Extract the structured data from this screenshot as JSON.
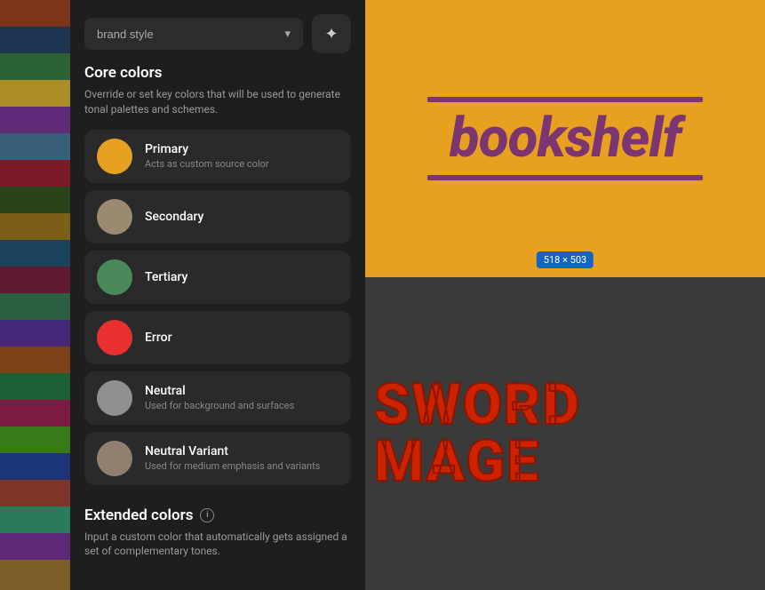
{
  "panel": {
    "dropdown_label": "brand style",
    "dropdown_icon": "▾",
    "magic_icon": "✦",
    "core_colors_title": "Core colors",
    "core_colors_desc": "Override or set key colors that will be used to generate tonal palettes and schemes.",
    "colors": [
      {
        "name": "Primary",
        "desc": "Acts as custom source color",
        "swatch": "#e8a020",
        "id": "primary"
      },
      {
        "name": "Secondary",
        "desc": "",
        "swatch": "#9a8a70",
        "id": "secondary"
      },
      {
        "name": "Tertiary",
        "desc": "",
        "swatch": "#4a8a5a",
        "id": "tertiary"
      },
      {
        "name": "Error",
        "desc": "",
        "swatch": "#e83030",
        "id": "error"
      },
      {
        "name": "Neutral",
        "desc": "Used for background and surfaces",
        "swatch": "#909090",
        "id": "neutral"
      },
      {
        "name": "Neutral Variant",
        "desc": "Used for medium emphasis and variants",
        "swatch": "#908070",
        "id": "neutral-variant"
      }
    ],
    "extended_title": "Extended colors",
    "extended_desc": "Input a custom color that automatically gets assigned a set of complementary tones."
  },
  "preview": {
    "logo_text": "bookshelf",
    "size_badge": "518 × 503",
    "sword_text": "SWORD MAGE"
  }
}
